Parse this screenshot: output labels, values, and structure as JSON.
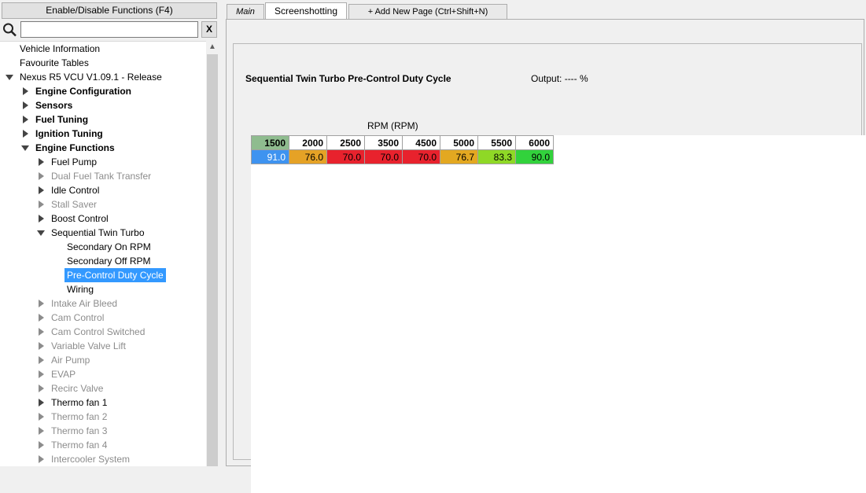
{
  "left_panel": {
    "enable_button": "Enable/Disable Functions (F4)",
    "search": {
      "value": "",
      "placeholder": ""
    },
    "clear_button": "X",
    "tree": [
      {
        "label": "Vehicle Information",
        "arrow": "none",
        "level": 0,
        "style": "normal"
      },
      {
        "label": "Favourite Tables",
        "arrow": "none",
        "level": 0,
        "style": "normal"
      },
      {
        "label": "Nexus R5 VCU V1.09.1 - Release",
        "arrow": "down",
        "level": 0,
        "style": "normal"
      },
      {
        "label": "Engine Configuration",
        "arrow": "right",
        "level": 1,
        "style": "bold"
      },
      {
        "label": "Sensors",
        "arrow": "right",
        "level": 1,
        "style": "bold"
      },
      {
        "label": "Fuel Tuning",
        "arrow": "right",
        "level": 1,
        "style": "bold"
      },
      {
        "label": "Ignition Tuning",
        "arrow": "right",
        "level": 1,
        "style": "bold"
      },
      {
        "label": "Engine Functions",
        "arrow": "down",
        "level": 1,
        "style": "bold"
      },
      {
        "label": "Fuel Pump",
        "arrow": "right",
        "level": 2,
        "style": "normal"
      },
      {
        "label": "Dual Fuel Tank Transfer",
        "arrow": "right",
        "level": 2,
        "style": "dim"
      },
      {
        "label": "Idle Control",
        "arrow": "right",
        "level": 2,
        "style": "normal"
      },
      {
        "label": "Stall Saver",
        "arrow": "right",
        "level": 2,
        "style": "dim"
      },
      {
        "label": "Boost Control",
        "arrow": "right",
        "level": 2,
        "style": "normal"
      },
      {
        "label": "Sequential Twin Turbo",
        "arrow": "down",
        "level": 2,
        "style": "normal"
      },
      {
        "label": "Secondary On RPM",
        "arrow": "none",
        "level": 3,
        "style": "normal"
      },
      {
        "label": "Secondary Off RPM",
        "arrow": "none",
        "level": 3,
        "style": "normal"
      },
      {
        "label": "Pre-Control Duty Cycle",
        "arrow": "none",
        "level": 3,
        "style": "selected"
      },
      {
        "label": "Wiring",
        "arrow": "none",
        "level": 3,
        "style": "normal"
      },
      {
        "label": "Intake Air Bleed",
        "arrow": "right",
        "level": 2,
        "style": "dim"
      },
      {
        "label": "Cam Control",
        "arrow": "right",
        "level": 2,
        "style": "dim"
      },
      {
        "label": "Cam Control Switched",
        "arrow": "right",
        "level": 2,
        "style": "dim"
      },
      {
        "label": "Variable Valve Lift",
        "arrow": "right",
        "level": 2,
        "style": "dim"
      },
      {
        "label": "Air Pump",
        "arrow": "right",
        "level": 2,
        "style": "dim"
      },
      {
        "label": "EVAP",
        "arrow": "right",
        "level": 2,
        "style": "dim"
      },
      {
        "label": "Recirc Valve",
        "arrow": "right",
        "level": 2,
        "style": "dim"
      },
      {
        "label": "Thermo fan 1",
        "arrow": "right",
        "level": 2,
        "style": "normal"
      },
      {
        "label": "Thermo fan 2",
        "arrow": "right",
        "level": 2,
        "style": "dim"
      },
      {
        "label": "Thermo fan 3",
        "arrow": "right",
        "level": 2,
        "style": "dim"
      },
      {
        "label": "Thermo fan 4",
        "arrow": "right",
        "level": 2,
        "style": "dim"
      },
      {
        "label": "Intercooler System",
        "arrow": "right",
        "level": 2,
        "style": "dim"
      }
    ]
  },
  "tabs": {
    "main": "Main",
    "screenshotting": "Screenshotting",
    "add_new_page": "+ Add New Page (Ctrl+Shift+N)"
  },
  "table_panel": {
    "title": "Sequential Twin Turbo Pre-Control Duty Cycle",
    "output": "Output: ---- %",
    "axis_label": "RPM (RPM)",
    "rpm": [
      "1500",
      "2000",
      "2500",
      "3500",
      "4500",
      "5000",
      "5500",
      "6000"
    ],
    "values": [
      "91.0",
      "76.0",
      "70.0",
      "70.0",
      "70.0",
      "76.7",
      "83.3",
      "90.0"
    ],
    "cell_colors": [
      "#3e93f0",
      "#e5a226",
      "#e8222d",
      "#e8222d",
      "#e8222d",
      "#e3a821",
      "#8fd826",
      "#32d23c"
    ]
  }
}
